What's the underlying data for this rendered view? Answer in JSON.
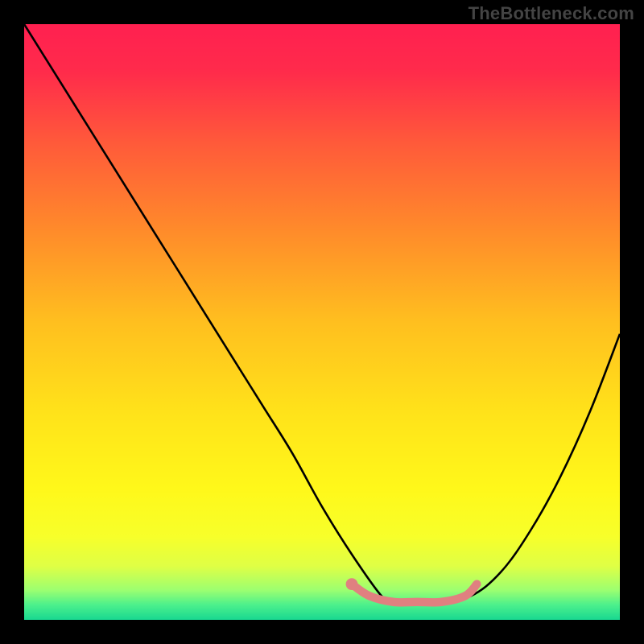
{
  "watermark": "TheBottleneck.com",
  "chart_data": {
    "type": "line",
    "title": "",
    "xlabel": "",
    "ylabel": "",
    "xlim": [
      0,
      100
    ],
    "ylim": [
      0,
      100
    ],
    "background_gradient_stops": [
      {
        "pos": 0.0,
        "color": "#ff2050"
      },
      {
        "pos": 0.08,
        "color": "#ff2b4b"
      },
      {
        "pos": 0.2,
        "color": "#ff5a3a"
      },
      {
        "pos": 0.35,
        "color": "#ff8c2a"
      },
      {
        "pos": 0.5,
        "color": "#ffbf1f"
      },
      {
        "pos": 0.65,
        "color": "#ffe21a"
      },
      {
        "pos": 0.78,
        "color": "#fff81a"
      },
      {
        "pos": 0.86,
        "color": "#f7ff2a"
      },
      {
        "pos": 0.91,
        "color": "#dfff45"
      },
      {
        "pos": 0.95,
        "color": "#9cff70"
      },
      {
        "pos": 0.975,
        "color": "#4cf08c"
      },
      {
        "pos": 1.0,
        "color": "#18d890"
      }
    ],
    "series": [
      {
        "name": "bottleneck-curve",
        "color": "#000000",
        "x": [
          0,
          5,
          10,
          15,
          20,
          25,
          30,
          35,
          40,
          45,
          50,
          55,
          60,
          62,
          65,
          70,
          75,
          80,
          85,
          90,
          95,
          100
        ],
        "y": [
          100,
          92,
          84,
          76,
          68,
          60,
          52,
          44,
          36,
          28,
          19,
          11,
          4,
          3,
          3,
          3,
          4,
          8,
          15,
          24,
          35,
          48
        ]
      }
    ],
    "highlight": {
      "name": "optimal-range",
      "color": "#e08080",
      "x": [
        55,
        58,
        62,
        66,
        70,
        74,
        76
      ],
      "y": [
        6,
        4,
        3,
        3,
        3,
        4,
        6
      ]
    },
    "highlight_marker": {
      "x": 55,
      "y": 6,
      "r": 1.0,
      "color": "#e08080"
    }
  }
}
